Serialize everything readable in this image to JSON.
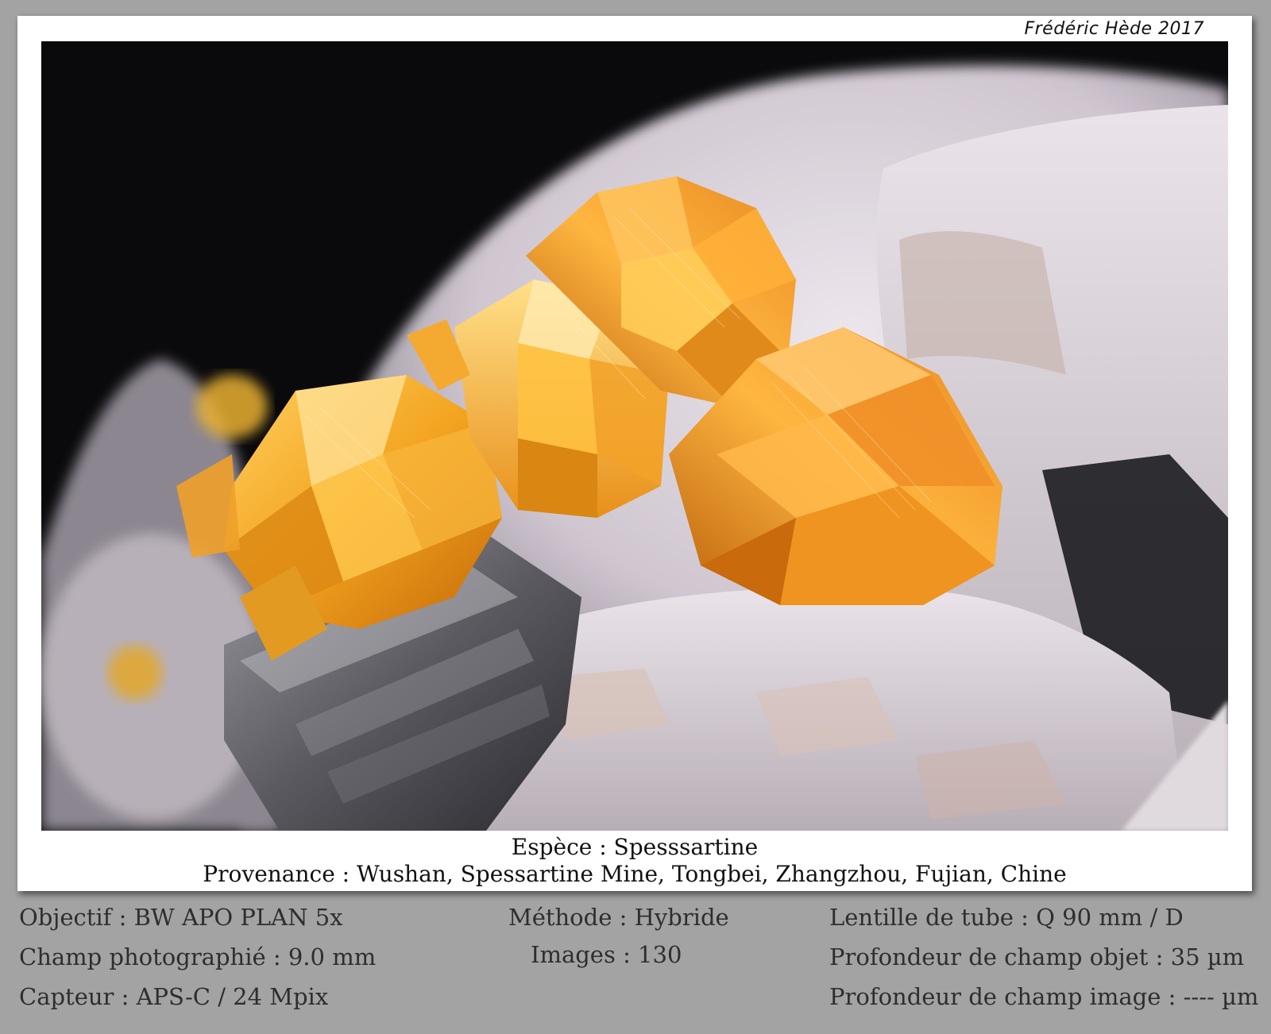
{
  "credit": "Frédéric Hède 2017",
  "caption": {
    "species": "Espèce : Spesssartine",
    "origin": "Provenance : Wushan, Spessartine Mine, Tongbei, Zhangzhou, Fujian, Chine"
  },
  "details": {
    "left": [
      "Objectif : BW APO PLAN 5x",
      "Champ photographié : 9.0 mm",
      "Capteur : APS-C / 24 Mpix"
    ],
    "middle": [
      "Méthode : Hybride",
      "Images : 130"
    ],
    "right": [
      "Lentille de tube : Q 90 mm / D",
      "Profondeur de champ objet : 35 µm",
      "Profondeur de champ image : ---- µm"
    ]
  },
  "colors": {
    "background": "#a3a3a3",
    "card": "#ffffff",
    "crystal": "#f0a020",
    "matrix": "#d8d4d8"
  }
}
